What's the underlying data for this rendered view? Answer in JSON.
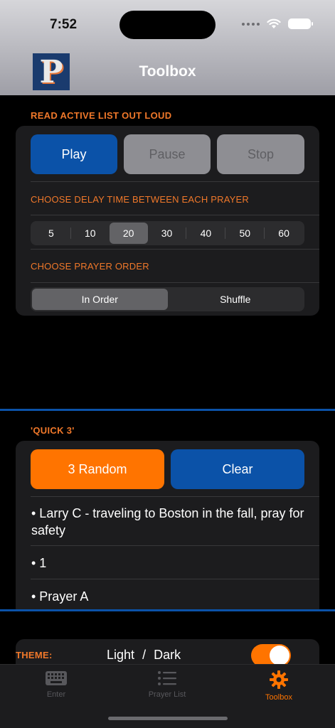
{
  "status": {
    "time": "7:52"
  },
  "nav": {
    "title": "Toolbox",
    "logo_letter": "P"
  },
  "read_aloud": {
    "section_label": "READ ACTIVE LIST OUT LOUD",
    "play_label": "Play",
    "pause_label": "Pause",
    "stop_label": "Stop",
    "delay_label": "CHOOSE DELAY TIME BETWEEN EACH PRAYER",
    "delay_options": [
      "5",
      "10",
      "20",
      "30",
      "40",
      "50",
      "60"
    ],
    "delay_selected": "20",
    "order_label": "CHOOSE PRAYER ORDER",
    "order_options": [
      "In Order",
      "Shuffle"
    ],
    "order_selected": "In Order"
  },
  "quick3": {
    "section_label": "'QUICK 3'",
    "random_label": "3 Random",
    "clear_label": "Clear",
    "items": [
      "• Larry C - traveling to Boston in the fall, pray for safety",
      "• 1",
      "• Prayer A"
    ]
  },
  "theme": {
    "label": "THEME:",
    "light": "Light",
    "separator": "/",
    "dark": "Dark",
    "toggle_on": true
  },
  "tabs": [
    {
      "label": "Enter",
      "icon": "keyboard-icon"
    },
    {
      "label": "Prayer List",
      "icon": "list-icon"
    },
    {
      "label": "Toolbox",
      "icon": "gear-icon"
    }
  ],
  "colors": {
    "accent": "#ff7400",
    "blue": "#0b52a8",
    "label_orange": "#f0782a"
  }
}
